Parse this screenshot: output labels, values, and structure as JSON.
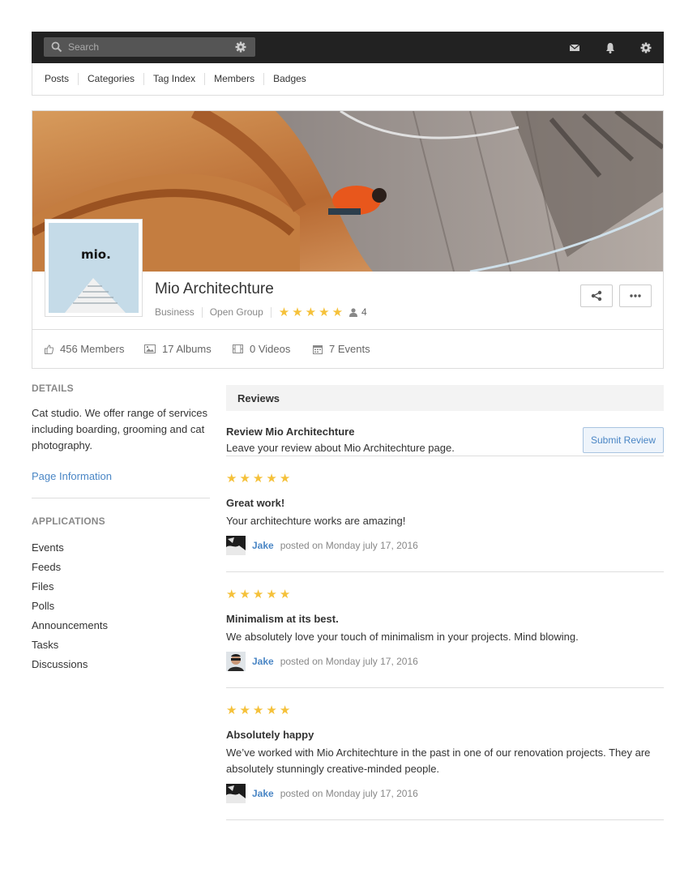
{
  "topbar": {
    "search_placeholder": "Search",
    "icons": [
      "search-icon",
      "gear-icon",
      "mail-icon",
      "bell-icon",
      "gear-icon"
    ]
  },
  "subnav": [
    "Posts",
    "Categories",
    "Tag Index",
    "Members",
    "Badges"
  ],
  "profile": {
    "logo_text": "mio.",
    "name": "Mio Architechture",
    "category": "Business",
    "group_type": "Open Group",
    "rating": 5,
    "member_count": "4"
  },
  "stats": {
    "members": "456 Members",
    "albums": "17 Albums",
    "videos": "0 Videos",
    "events": "7 Events"
  },
  "details": {
    "heading": "DETAILS",
    "description": "Cat studio. We offer range of services including boarding, grooming and cat photography.",
    "link": "Page Information"
  },
  "applications": {
    "heading": "APPLICATIONS",
    "items": [
      "Events",
      "Feeds",
      "Files",
      "Polls",
      "Announcements",
      "Tasks",
      "Discussions"
    ]
  },
  "reviews": {
    "heading": "Reviews",
    "cta_title": "Review Mio Architechture",
    "cta_text": "Leave your review about Mio Architechture page.",
    "submit_label": "Submit Review",
    "items": [
      {
        "rating": 5,
        "title": "Great work!",
        "body": "Your architechture works are amazing!",
        "author": "Jake",
        "posted": "posted on Monday july 17, 2016"
      },
      {
        "rating": 5,
        "title": "Minimalism at its best.",
        "body": "We absolutely love your touch of minimalism in your projects. Mind blowing.",
        "author": "Jake",
        "posted": "posted on Monday july 17, 2016"
      },
      {
        "rating": 5,
        "title": "Absolutely happy",
        "body": "We’ve worked with Mio Architechture in the past in one of our renovation projects. They are absolutely stunningly creative-minded people.",
        "author": "Jake",
        "posted": "posted on Monday july 17, 2016"
      }
    ]
  },
  "colors": {
    "topbar": "#222222",
    "link": "#4a86c5",
    "star": "#f5c13a"
  }
}
